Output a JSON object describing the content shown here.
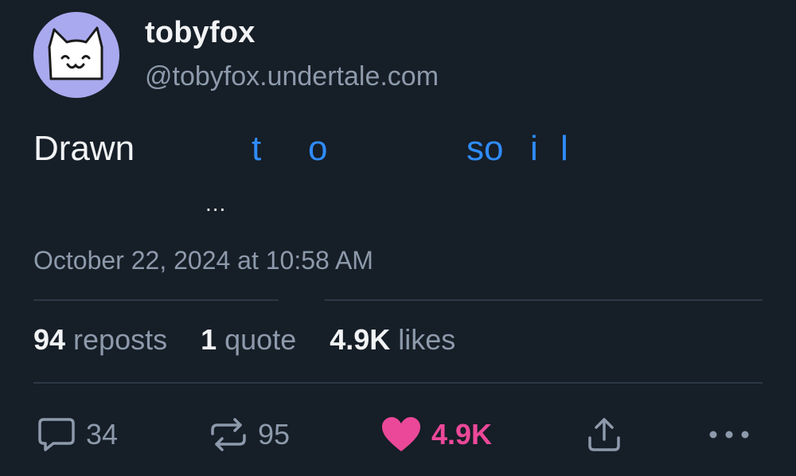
{
  "author": {
    "display_name": "tobyfox",
    "handle": "@tobyfox.undertale.com",
    "avatar": "white-cat-face-avatar"
  },
  "post": {
    "text_start": "Drawn",
    "link_fragments": [
      "t",
      "o",
      "so",
      "i",
      "l"
    ],
    "more_indicator": "...",
    "timestamp": "October 22, 2024 at 10:58 AM"
  },
  "stats": {
    "reposts_count": "94",
    "reposts_label": " reposts",
    "quotes_count": "1",
    "quotes_label": " quote",
    "likes_count": "4.9K",
    "likes_label": " likes"
  },
  "actions": {
    "reply_icon": "speech-bubble-icon",
    "reply_count": "34",
    "repost_icon": "repost-arrows-icon",
    "repost_count": "95",
    "like_icon": "heart-icon",
    "like_count": "4.9K",
    "share_icon": "share-upload-icon",
    "more_icon": "ellipsis-icon"
  },
  "colors": {
    "background": "#161e27",
    "text": "#f1f3f5",
    "muted": "#8d9aab",
    "link": "#2f8cff",
    "like": "#ec4899",
    "divider": "#2c3845",
    "avatar_bg": "#a9a9ef"
  }
}
